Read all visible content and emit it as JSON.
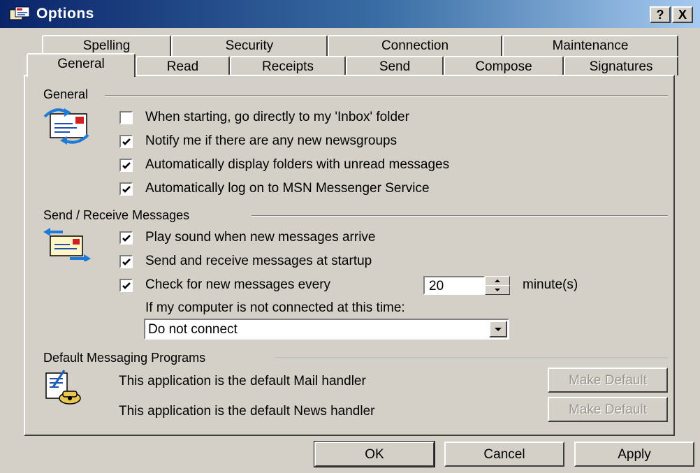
{
  "window": {
    "title": "Options",
    "help_button": "?",
    "close_button": "X"
  },
  "tabs_row1": [
    "Spelling",
    "Security",
    "Connection",
    "Maintenance"
  ],
  "tabs_row2": [
    "General",
    "Read",
    "Receipts",
    "Send",
    "Compose",
    "Signatures"
  ],
  "active_tab": "General",
  "general_section": {
    "title": "General",
    "icon": "mailbox-switch-icon",
    "options": [
      {
        "label": "When starting, go directly to my 'Inbox' folder",
        "checked": false
      },
      {
        "label": "Notify me if there are any new newsgroups",
        "checked": true
      },
      {
        "label": "Automatically display folders with unread messages",
        "checked": true
      },
      {
        "label": "Automatically log on to MSN Messenger Service",
        "checked": true
      }
    ]
  },
  "send_receive_section": {
    "title": "Send / Receive Messages",
    "icon": "send-receive-icon",
    "options": [
      {
        "label": "Play sound when new messages arrive",
        "checked": true
      },
      {
        "label": "Send and receive messages at startup",
        "checked": true
      },
      {
        "label": "Check for new messages every",
        "checked": true
      }
    ],
    "interval_value": "20",
    "interval_unit": "minute(s)",
    "not_connected_label": "If my computer is not connected at this time:",
    "connect_option": "Do not connect"
  },
  "default_programs_section": {
    "title": "Default Messaging Programs",
    "icon": "default-programs-icon",
    "mail_status": "This application is the default Mail handler",
    "news_status": "This application is the default News handler",
    "make_default_label": "Make Default"
  },
  "footer": {
    "ok": "OK",
    "cancel": "Cancel",
    "apply": "Apply"
  },
  "colors": {
    "dialog_face": "#d4d0c8",
    "title_gradient_start": "#0a246a",
    "title_gradient_end": "#a6caf0"
  }
}
